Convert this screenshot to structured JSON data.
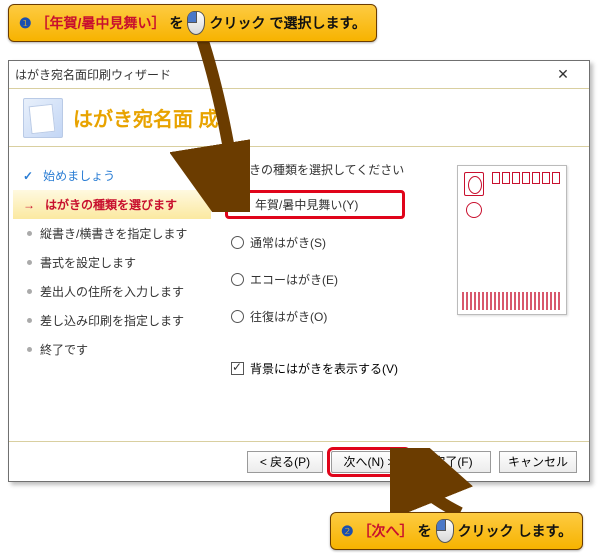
{
  "callout1": {
    "num": "❶",
    "hl": "［年賀/暑中見舞い］",
    "mid": "を",
    "click": "クリック",
    "tail": "で選択します。"
  },
  "callout2": {
    "num": "❷",
    "hl": "［次へ］",
    "mid": "を",
    "click": "クリック",
    "tail": "します。"
  },
  "dialog": {
    "title": "はがき宛名面印刷ウィザード",
    "header": "はがき宛名面    成"
  },
  "steps": [
    {
      "label": "始めましょう"
    },
    {
      "label": "はがきの種類を選びます"
    },
    {
      "label": "縦書き/横書きを指定します"
    },
    {
      "label": "書式を設定します"
    },
    {
      "label": "差出人の住所を入力します"
    },
    {
      "label": "差し込み印刷を指定します"
    },
    {
      "label": "終了です"
    }
  ],
  "prompt": "はがきの種類を選択してください",
  "options": [
    {
      "label": "年賀/暑中見舞い(Y)",
      "checked": true
    },
    {
      "label": "通常はがき(S)",
      "checked": false
    },
    {
      "label": "エコーはがき(E)",
      "checked": false
    },
    {
      "label": "往復はがき(O)",
      "checked": false
    }
  ],
  "checkbox": {
    "label": "背景にはがきを表示する(V)",
    "checked": true
  },
  "buttons": {
    "back": "< 戻る(P)",
    "next": "次へ(N) >",
    "finish": "完了(F)",
    "cancel": "キャンセル"
  }
}
